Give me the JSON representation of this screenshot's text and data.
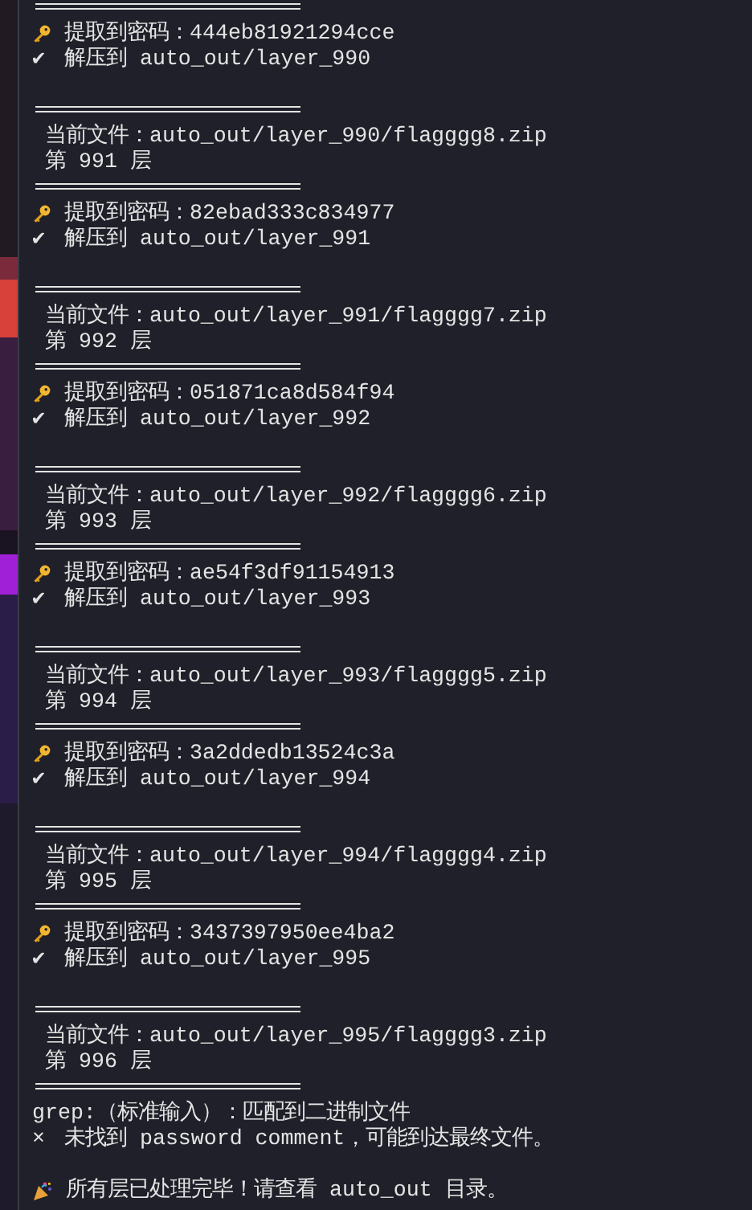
{
  "terminal": {
    "lines": [
      {
        "kind": "divider"
      },
      {
        "kind": "key",
        "text": "提取到密码：444eb81921294cce"
      },
      {
        "kind": "mark",
        "mark": "✔",
        "text": "解压到 auto_out/layer_990"
      },
      {
        "kind": "blank"
      },
      {
        "kind": "divider"
      },
      {
        "kind": "info",
        "text": "当前文件：auto_out/layer_990/flagggg8.zip"
      },
      {
        "kind": "info",
        "text": "第 991 层"
      },
      {
        "kind": "divider"
      },
      {
        "kind": "key",
        "text": "提取到密码：82ebad333c834977"
      },
      {
        "kind": "mark",
        "mark": "✔",
        "text": "解压到 auto_out/layer_991"
      },
      {
        "kind": "blank"
      },
      {
        "kind": "divider"
      },
      {
        "kind": "info",
        "text": "当前文件：auto_out/layer_991/flagggg7.zip"
      },
      {
        "kind": "info",
        "text": "第 992 层"
      },
      {
        "kind": "divider"
      },
      {
        "kind": "key",
        "text": "提取到密码：051871ca8d584f94"
      },
      {
        "kind": "mark",
        "mark": "✔",
        "text": "解压到 auto_out/layer_992"
      },
      {
        "kind": "blank"
      },
      {
        "kind": "divider"
      },
      {
        "kind": "info",
        "text": "当前文件：auto_out/layer_992/flagggg6.zip"
      },
      {
        "kind": "info",
        "text": "第 993 层"
      },
      {
        "kind": "divider"
      },
      {
        "kind": "key",
        "text": "提取到密码：ae54f3df91154913"
      },
      {
        "kind": "mark",
        "mark": "✔",
        "text": "解压到 auto_out/layer_993"
      },
      {
        "kind": "blank"
      },
      {
        "kind": "divider"
      },
      {
        "kind": "info",
        "text": "当前文件：auto_out/layer_993/flagggg5.zip"
      },
      {
        "kind": "info",
        "text": "第 994 层"
      },
      {
        "kind": "divider"
      },
      {
        "kind": "key",
        "text": "提取到密码：3a2ddedb13524c3a"
      },
      {
        "kind": "mark",
        "mark": "✔",
        "text": "解压到 auto_out/layer_994"
      },
      {
        "kind": "blank"
      },
      {
        "kind": "divider"
      },
      {
        "kind": "info",
        "text": "当前文件：auto_out/layer_994/flagggg4.zip"
      },
      {
        "kind": "info",
        "text": "第 995 层"
      },
      {
        "kind": "divider"
      },
      {
        "kind": "key",
        "text": "提取到密码：3437397950ee4ba2"
      },
      {
        "kind": "mark",
        "mark": "✔",
        "text": "解压到 auto_out/layer_995"
      },
      {
        "kind": "blank"
      },
      {
        "kind": "divider"
      },
      {
        "kind": "info",
        "text": "当前文件：auto_out/layer_995/flagggg3.zip"
      },
      {
        "kind": "info",
        "text": "第 996 层"
      },
      {
        "kind": "divider"
      },
      {
        "kind": "plain",
        "text": "grep:（标准输入）：匹配到二进制文件"
      },
      {
        "kind": "mark",
        "mark": "×",
        "text": "未找到 password comment，可能到达最终文件。"
      },
      {
        "kind": "blank"
      },
      {
        "kind": "party",
        "text": "所有层已处理完毕！请查看 auto_out 目录。"
      }
    ]
  }
}
